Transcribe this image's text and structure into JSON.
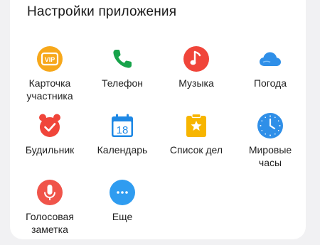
{
  "title": "Настройки приложения",
  "apps": [
    {
      "label": "Карточка\nучастника",
      "icon": "vip-card-icon",
      "color": "#F7A81B"
    },
    {
      "label": "Телефон",
      "icon": "phone-icon",
      "color": "#17A34A"
    },
    {
      "label": "Музыка",
      "icon": "music-icon",
      "color": "#F0453A"
    },
    {
      "label": "Погода",
      "icon": "cloud-icon",
      "color": "#2F8FE8"
    },
    {
      "label": "Будильник",
      "icon": "alarm-clock-icon",
      "color": "#F0453A"
    },
    {
      "label": "Календарь",
      "icon": "calendar-icon",
      "color": "#1E88E5",
      "day": "18"
    },
    {
      "label": "Список дел",
      "icon": "todo-list-icon",
      "color": "#F7B500"
    },
    {
      "label": "Мировые\nчасы",
      "icon": "world-clock-icon",
      "color": "#2F8FE8"
    },
    {
      "label": "Голосовая\nзаметка",
      "icon": "voice-memo-icon",
      "color": "#F0544A"
    },
    {
      "label": "Еще",
      "icon": "more-icon",
      "color": "#2F9CF0"
    }
  ]
}
